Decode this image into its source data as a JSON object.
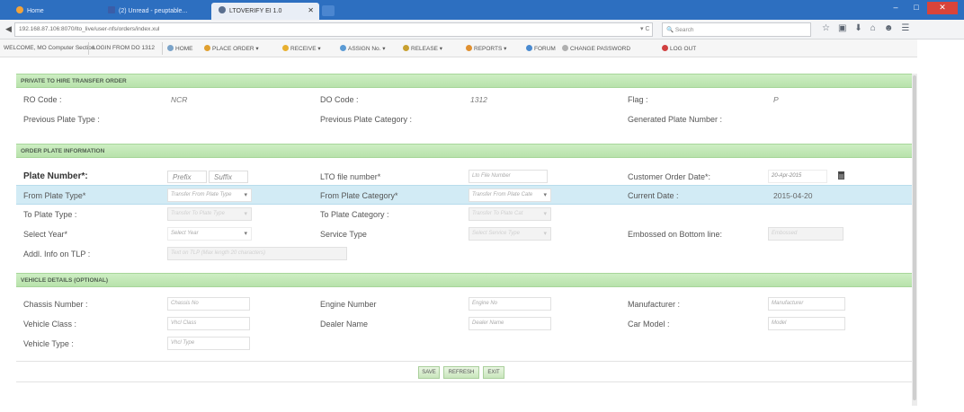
{
  "browser": {
    "tabs": [
      {
        "label": "Home"
      },
      {
        "label": "(2) Unread - peuptable..."
      },
      {
        "label": "LTOVERIFY EI 1.0"
      }
    ],
    "url": "192.168.87.106:8070/lto_live/user-nfs/orders/index.xul",
    "search_placeholder": "Search"
  },
  "app_menu": {
    "welcome": "WELCOME, MO Computer Section",
    "login_from": "LOGIN FROM DO 1312",
    "items": [
      {
        "label": "HOME",
        "icon": "home-icon"
      },
      {
        "label": "PLACE ORDER ▾",
        "icon": "order-icon"
      },
      {
        "label": "RECEIVE ▾",
        "icon": "receive-icon"
      },
      {
        "label": "ASSIGN No. ▾",
        "icon": "assign-icon"
      },
      {
        "label": "RELEASE ▾",
        "icon": "release-icon"
      },
      {
        "label": "REPORTS ▾",
        "icon": "reports-icon"
      },
      {
        "label": "FORUM",
        "icon": "forum-icon"
      },
      {
        "label": "CHANGE PASSWORD",
        "icon": "key-icon"
      },
      {
        "label": "LOG OUT",
        "icon": "logout-icon"
      }
    ]
  },
  "sections": {
    "transfer": "PRIVATE TO HIRE TRANSFER ORDER",
    "order_plate": "ORDER PLATE INFORMATION",
    "vehicle": "VEHICLE DETAILS (OPTIONAL)"
  },
  "transfer": {
    "ro_code_label": "RO Code :",
    "ro_code_value": "NCR",
    "do_code_label": "DO Code :",
    "do_code_value": "1312",
    "flag_label": "Flag :",
    "flag_value": "P",
    "prev_plate_type_label": "Previous Plate Type :",
    "prev_plate_cat_label": "Previous Plate Category :",
    "generated_plate_label": "Generated Plate Number :"
  },
  "order_plate": {
    "plate_number_label": "Plate Number*:",
    "prefix_placeholder": "Prefix",
    "suffix_placeholder": "Suffix",
    "lto_file_label": "LTO file number*",
    "lto_file_placeholder": "Lto File Number",
    "customer_date_label": "Customer Order Date*:",
    "customer_date_value": "20-Apr-2015",
    "from_plate_type_label": "From Plate Type*",
    "from_plate_type_value": "Transfer From Plate Type",
    "from_plate_cat_label": "From Plate Category*",
    "from_plate_cat_value": "Transfer From Plate Cate",
    "current_date_label": "Current Date :",
    "current_date_value": "2015-04-20",
    "to_plate_type_label": "To Plate Type :",
    "to_plate_type_value": "Transfer To Plate Type",
    "to_plate_cat_label": "To Plate Category :",
    "to_plate_cat_value": "Transfer To Plate Cat",
    "select_year_label": "Select Year*",
    "select_year_value": "Select Year",
    "service_type_label": "Service Type",
    "service_type_value": "Select Service Type",
    "embossed_label": "Embossed on Bottom line:",
    "embossed_value": "Embossed",
    "addl_info_label": "Addl. Info on TLP :",
    "addl_info_value": "Text on TLP (Max length 20 characters)"
  },
  "vehicle": {
    "chassis_label": "Chassis Number :",
    "chassis_placeholder": "Chassis No",
    "engine_label": "Engine Number",
    "engine_placeholder": "Engine No",
    "manufacturer_label": "Manufacturer :",
    "manufacturer_placeholder": "Manufacturer",
    "vclass_label": "Vehicle Class :",
    "vclass_placeholder": "Vhcl Class",
    "dealer_label": "Dealer Name",
    "dealer_placeholder": "Dealer Name",
    "model_label": "Car Model :",
    "model_placeholder": "Model",
    "vtype_label": "Vehicle Type :",
    "vtype_placeholder": "Vhcl Type"
  },
  "buttons": {
    "save": "SAVE",
    "refresh": "REFRESH",
    "exit": "EXIT"
  },
  "colors": {
    "section_green": "#c4e8b8",
    "selected_row": "#d2ebf5",
    "tabbar_blue": "#2d6fc0"
  }
}
